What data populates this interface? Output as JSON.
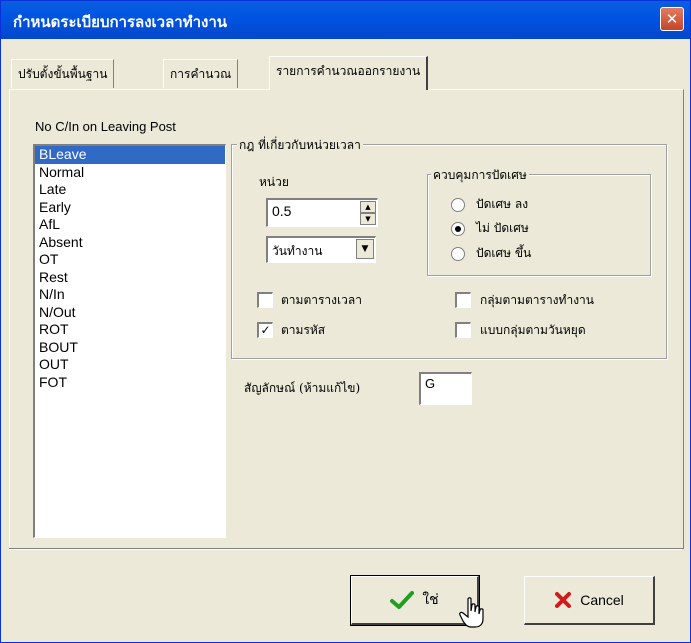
{
  "window": {
    "title": "กำหนดระเบียบการลงเวลาทำงาน",
    "close_glyph": "✕"
  },
  "tabs": [
    {
      "label": "ปรับตั้งขั้นพื้นฐาน",
      "active": false
    },
    {
      "label": "การคำนวณ",
      "active": false
    },
    {
      "label": "รายการคำนวณออกรายงาน",
      "active": true
    }
  ],
  "list": {
    "label": "No C/In on Leaving Post",
    "items": [
      "BLeave",
      "Normal",
      "Late",
      "Early",
      "AfL",
      "Absent",
      "OT",
      "Rest",
      "N/In",
      "N/Out",
      "ROT",
      "BOUT",
      "OUT",
      "FOT"
    ],
    "selected_index": 0
  },
  "time_unit_group": {
    "title": "กฎ ที่เกี่ยวกับหน่วยเวลา",
    "unit_label": "หน่วย",
    "unit_value": "0.5",
    "unit_type_value": "วันทำงาน"
  },
  "rounding_group": {
    "title": "ควบคุมการปัดเศษ",
    "options": [
      {
        "label": "ปัดเศษ ลง",
        "selected": false
      },
      {
        "label": "ไม่ ปัดเศษ",
        "selected": true
      },
      {
        "label": "ปัดเศษ ขึ้น",
        "selected": false
      }
    ]
  },
  "checkboxes": {
    "by_time_table": {
      "label": "ตามตารางเวลา",
      "checked": false
    },
    "by_work_table_group": {
      "label": "กลุ่มตามตารางทำงาน",
      "checked": false
    },
    "by_code": {
      "label": "ตามรหัส",
      "checked": true
    },
    "by_holiday_group": {
      "label": "แบบกลุ่มตามวันหยุด",
      "checked": false
    }
  },
  "symbol": {
    "label": "สัญลักษณ์ (ห้ามแก้ไข)",
    "value": "G"
  },
  "buttons": {
    "ok_label": "ใช่",
    "cancel_label": "Cancel"
  },
  "colors": {
    "titlebar": "#0054e3",
    "selection": "#316ac5",
    "window_bg": "#ece9d8",
    "ok_check": "#1f9e1f",
    "cancel_x": "#d11a1a"
  }
}
